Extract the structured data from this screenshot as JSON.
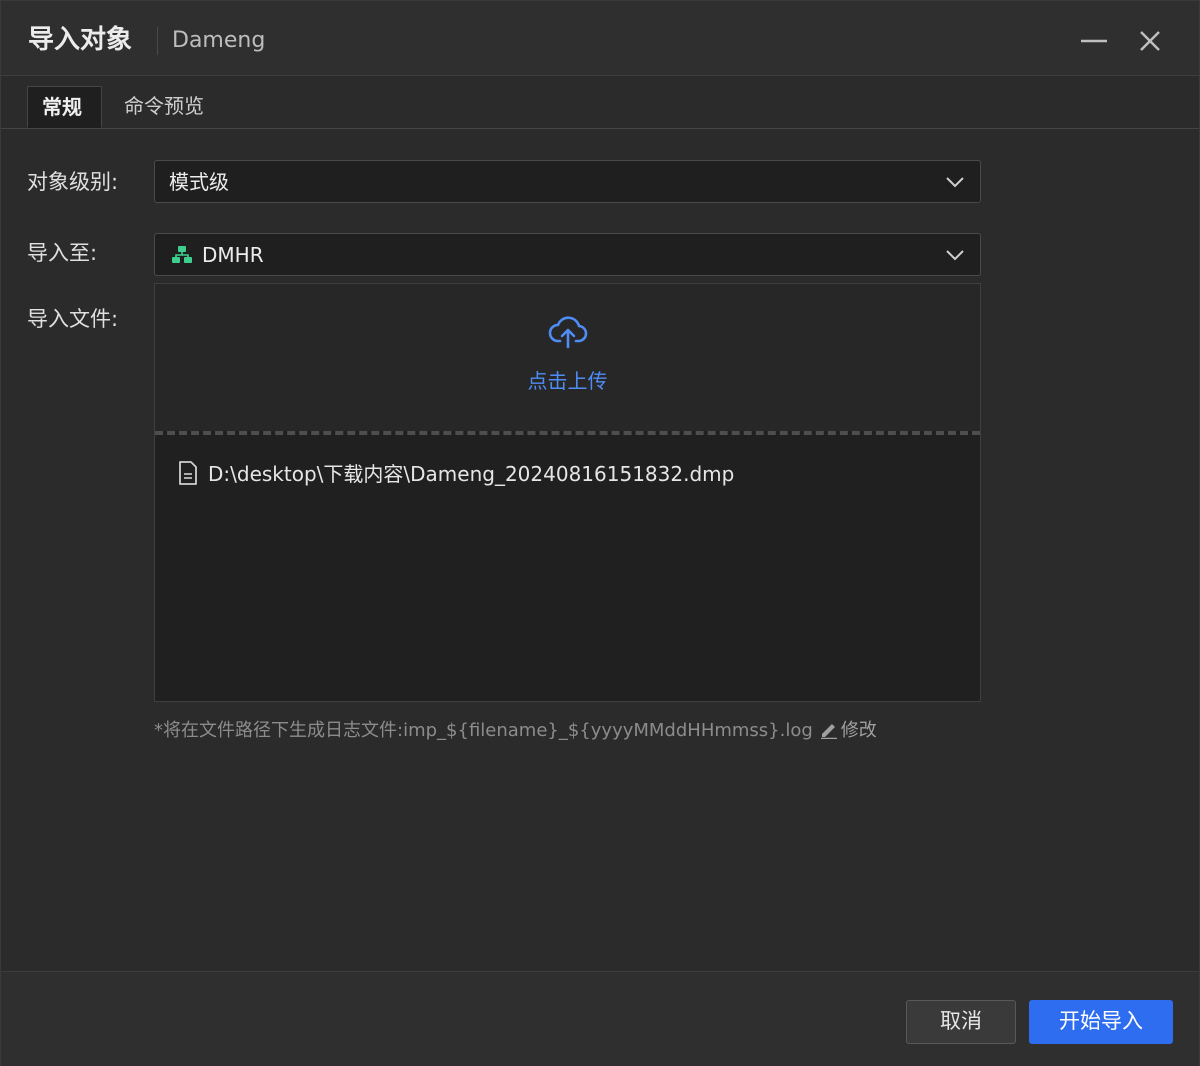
{
  "window": {
    "title": "导入对象",
    "subtitle": "Dameng"
  },
  "tabs": [
    {
      "label": "常规",
      "active": true
    },
    {
      "label": "命令预览",
      "active": false
    }
  ],
  "form": {
    "object_level": {
      "label": "对象级别:",
      "value": "模式级"
    },
    "import_to": {
      "label": "导入至:",
      "value": "DMHR",
      "icon": "schema-icon"
    },
    "import_file": {
      "label": "导入文件:",
      "upload_text": "点击上传",
      "files": [
        {
          "path": "D:\\desktop\\下载内容\\Dameng_20240816151832.dmp",
          "icon": "file-icon"
        }
      ]
    },
    "hint": {
      "prefix": "*将在文件路径下生成日志文件:",
      "pattern": "imp_${filename}_${yyyyMMddHHmmss}.log",
      "edit_label": "修改"
    }
  },
  "footer": {
    "cancel_label": "取消",
    "start_label": "开始导入"
  },
  "colors": {
    "accent": "#2f6df0",
    "link": "#4f8cf5",
    "schema_icon": "#3ecf8e"
  }
}
